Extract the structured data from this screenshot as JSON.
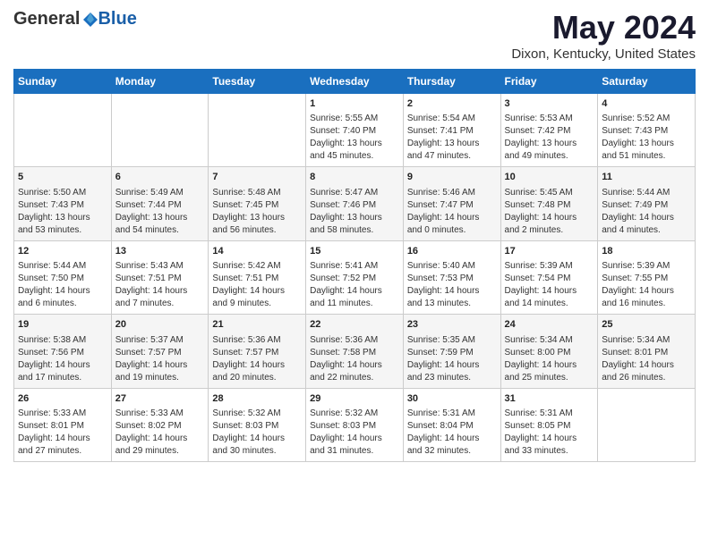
{
  "logo": {
    "general": "General",
    "blue": "Blue"
  },
  "title": "May 2024",
  "subtitle": "Dixon, Kentucky, United States",
  "days_of_week": [
    "Sunday",
    "Monday",
    "Tuesday",
    "Wednesday",
    "Thursday",
    "Friday",
    "Saturday"
  ],
  "weeks": [
    [
      {
        "day": "",
        "info": ""
      },
      {
        "day": "",
        "info": ""
      },
      {
        "day": "",
        "info": ""
      },
      {
        "day": "1",
        "info": "Sunrise: 5:55 AM\nSunset: 7:40 PM\nDaylight: 13 hours\nand 45 minutes."
      },
      {
        "day": "2",
        "info": "Sunrise: 5:54 AM\nSunset: 7:41 PM\nDaylight: 13 hours\nand 47 minutes."
      },
      {
        "day": "3",
        "info": "Sunrise: 5:53 AM\nSunset: 7:42 PM\nDaylight: 13 hours\nand 49 minutes."
      },
      {
        "day": "4",
        "info": "Sunrise: 5:52 AM\nSunset: 7:43 PM\nDaylight: 13 hours\nand 51 minutes."
      }
    ],
    [
      {
        "day": "5",
        "info": "Sunrise: 5:50 AM\nSunset: 7:43 PM\nDaylight: 13 hours\nand 53 minutes."
      },
      {
        "day": "6",
        "info": "Sunrise: 5:49 AM\nSunset: 7:44 PM\nDaylight: 13 hours\nand 54 minutes."
      },
      {
        "day": "7",
        "info": "Sunrise: 5:48 AM\nSunset: 7:45 PM\nDaylight: 13 hours\nand 56 minutes."
      },
      {
        "day": "8",
        "info": "Sunrise: 5:47 AM\nSunset: 7:46 PM\nDaylight: 13 hours\nand 58 minutes."
      },
      {
        "day": "9",
        "info": "Sunrise: 5:46 AM\nSunset: 7:47 PM\nDaylight: 14 hours\nand 0 minutes."
      },
      {
        "day": "10",
        "info": "Sunrise: 5:45 AM\nSunset: 7:48 PM\nDaylight: 14 hours\nand 2 minutes."
      },
      {
        "day": "11",
        "info": "Sunrise: 5:44 AM\nSunset: 7:49 PM\nDaylight: 14 hours\nand 4 minutes."
      }
    ],
    [
      {
        "day": "12",
        "info": "Sunrise: 5:44 AM\nSunset: 7:50 PM\nDaylight: 14 hours\nand 6 minutes."
      },
      {
        "day": "13",
        "info": "Sunrise: 5:43 AM\nSunset: 7:51 PM\nDaylight: 14 hours\nand 7 minutes."
      },
      {
        "day": "14",
        "info": "Sunrise: 5:42 AM\nSunset: 7:51 PM\nDaylight: 14 hours\nand 9 minutes."
      },
      {
        "day": "15",
        "info": "Sunrise: 5:41 AM\nSunset: 7:52 PM\nDaylight: 14 hours\nand 11 minutes."
      },
      {
        "day": "16",
        "info": "Sunrise: 5:40 AM\nSunset: 7:53 PM\nDaylight: 14 hours\nand 13 minutes."
      },
      {
        "day": "17",
        "info": "Sunrise: 5:39 AM\nSunset: 7:54 PM\nDaylight: 14 hours\nand 14 minutes."
      },
      {
        "day": "18",
        "info": "Sunrise: 5:39 AM\nSunset: 7:55 PM\nDaylight: 14 hours\nand 16 minutes."
      }
    ],
    [
      {
        "day": "19",
        "info": "Sunrise: 5:38 AM\nSunset: 7:56 PM\nDaylight: 14 hours\nand 17 minutes."
      },
      {
        "day": "20",
        "info": "Sunrise: 5:37 AM\nSunset: 7:57 PM\nDaylight: 14 hours\nand 19 minutes."
      },
      {
        "day": "21",
        "info": "Sunrise: 5:36 AM\nSunset: 7:57 PM\nDaylight: 14 hours\nand 20 minutes."
      },
      {
        "day": "22",
        "info": "Sunrise: 5:36 AM\nSunset: 7:58 PM\nDaylight: 14 hours\nand 22 minutes."
      },
      {
        "day": "23",
        "info": "Sunrise: 5:35 AM\nSunset: 7:59 PM\nDaylight: 14 hours\nand 23 minutes."
      },
      {
        "day": "24",
        "info": "Sunrise: 5:34 AM\nSunset: 8:00 PM\nDaylight: 14 hours\nand 25 minutes."
      },
      {
        "day": "25",
        "info": "Sunrise: 5:34 AM\nSunset: 8:01 PM\nDaylight: 14 hours\nand 26 minutes."
      }
    ],
    [
      {
        "day": "26",
        "info": "Sunrise: 5:33 AM\nSunset: 8:01 PM\nDaylight: 14 hours\nand 27 minutes."
      },
      {
        "day": "27",
        "info": "Sunrise: 5:33 AM\nSunset: 8:02 PM\nDaylight: 14 hours\nand 29 minutes."
      },
      {
        "day": "28",
        "info": "Sunrise: 5:32 AM\nSunset: 8:03 PM\nDaylight: 14 hours\nand 30 minutes."
      },
      {
        "day": "29",
        "info": "Sunrise: 5:32 AM\nSunset: 8:03 PM\nDaylight: 14 hours\nand 31 minutes."
      },
      {
        "day": "30",
        "info": "Sunrise: 5:31 AM\nSunset: 8:04 PM\nDaylight: 14 hours\nand 32 minutes."
      },
      {
        "day": "31",
        "info": "Sunrise: 5:31 AM\nSunset: 8:05 PM\nDaylight: 14 hours\nand 33 minutes."
      },
      {
        "day": "",
        "info": ""
      }
    ]
  ]
}
